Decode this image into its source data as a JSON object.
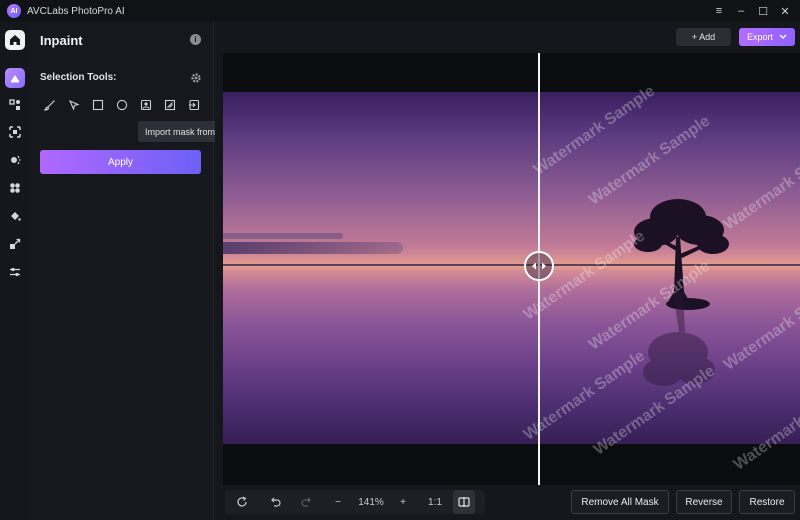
{
  "app": {
    "title": "AVCLabs PhotoPro AI",
    "logo_text": "AI"
  },
  "window": {
    "minimize": "–",
    "maximize": "☐",
    "close": "✕",
    "menu": "≡"
  },
  "panel": {
    "title": "Inpaint",
    "selection_label": "Selection Tools:",
    "tooltip": "Import mask from local",
    "apply_label": "Apply"
  },
  "topbar": {
    "add_label": "+ Add",
    "export_label": "Export"
  },
  "watermark_text": "Watermark Sample",
  "bottombar": {
    "zoom_value": "141%",
    "one_to_one": "1:1",
    "remove_all_mask": "Remove All Mask",
    "reverse": "Reverse",
    "restore": "Restore"
  }
}
